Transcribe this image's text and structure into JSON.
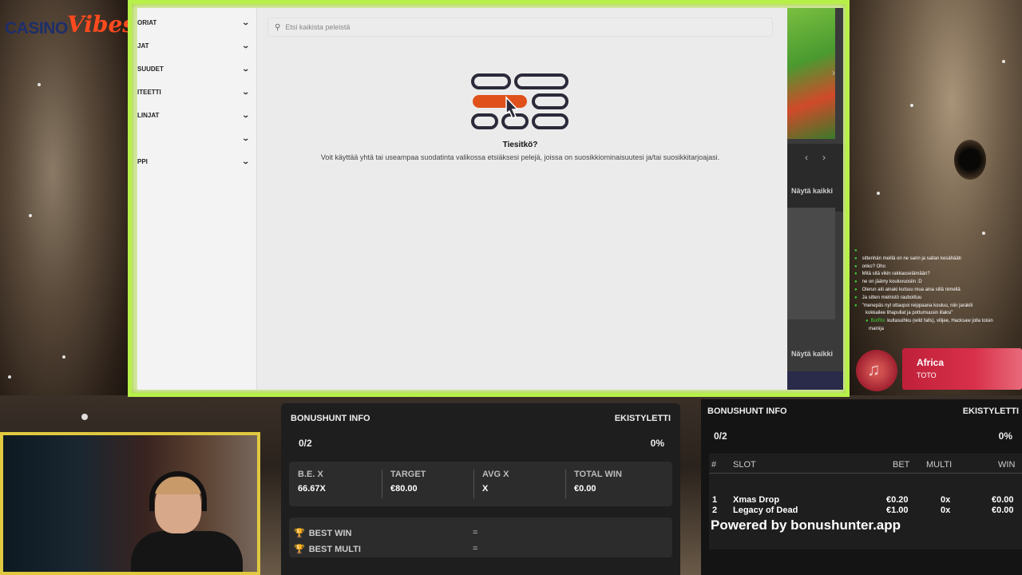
{
  "logo": {
    "word1": "CASINO",
    "word2": "Vibes"
  },
  "sidebar": {
    "items": [
      {
        "label": "ORIAT"
      },
      {
        "label": "JAT"
      },
      {
        "label": "SUUDET"
      },
      {
        "label": "ITEETTI"
      },
      {
        "label": "LINJAT"
      },
      {
        "label": ""
      },
      {
        "label": "PPI"
      }
    ]
  },
  "search": {
    "placeholder": "Etsi kaikista peleistä"
  },
  "tip": {
    "title": "Tiesitkö?",
    "text": "Voit käyttää yhtä tai useampaa suodatinta valikossa etsiäksesi pelejä, joissa on suosikkiominaisuutesi ja/tai suosikkitarjoajasi."
  },
  "sidepanel": {
    "show_all_1": "Näytä kaikki",
    "show_all_2": "Näytä kaikki"
  },
  "chat": [
    {
      "user": "",
      "msg": ""
    },
    {
      "user": "",
      "msg": "sittenhän meillä on ne sarin ja sallan kesähääti"
    },
    {
      "user": "",
      "msg": "onko? Oho"
    },
    {
      "user": "",
      "msg": "Mitä sitä vikin rakkauselämään?"
    },
    {
      "user": "",
      "msg": "ne on jäämy kouluvuosiin :D"
    },
    {
      "user": "",
      "msg": "Olerun aiti ainaki kutsuu mua aina sillä nimellä"
    },
    {
      "user": "",
      "msg": "Ja sitten miehistö rauboittuu"
    },
    {
      "user": "",
      "msg": "\"menepäs nyt ottaupoi reippaana kouluu, niin jaraklli"
    },
    {
      "user": "",
      "msg": "kokkailee lihapullat ja pottumuusin illaksi\""
    },
    {
      "user": "BotRix",
      "msg": "kultasulhku (wild falls), vilijee, Hacksaw jolla toisin"
    },
    {
      "user": "",
      "msg": "mainija"
    }
  ],
  "now_playing": {
    "artist": "Africa",
    "track": "TOTO"
  },
  "bonushunt1": {
    "title": "BONUSHUNT INFO",
    "mode": "EKISTYLETTI",
    "progress": "0/2",
    "percent": "0%",
    "stats": [
      {
        "label": "B.E. X",
        "value": "66.67X"
      },
      {
        "label": "TARGET",
        "value": "€80.00"
      },
      {
        "label": "AVG X",
        "value": "X"
      },
      {
        "label": "TOTAL WIN",
        "value": "€0.00"
      }
    ],
    "best_win_label": "BEST WIN",
    "best_win_value": "=",
    "best_multi_label": "BEST MULTI",
    "best_multi_value": "="
  },
  "bonushunt2": {
    "title": "BONUSHUNT INFO",
    "mode": "EKISTYLETTI",
    "progress": "0/2",
    "percent": "0%",
    "headers": {
      "num": "#",
      "slot": "SLOT",
      "bet": "BET",
      "multi": "MULTI",
      "win": "WIN"
    },
    "rows": [
      {
        "num": "1",
        "slot": "Xmas Drop",
        "bet": "€0.20",
        "multi": "0x",
        "win": "€0.00"
      },
      {
        "num": "2",
        "slot": "Legacy of Dead",
        "bet": "€1.00",
        "multi": "0x",
        "win": "€0.00"
      }
    ],
    "powered": "Powered by bonushunter.app"
  }
}
